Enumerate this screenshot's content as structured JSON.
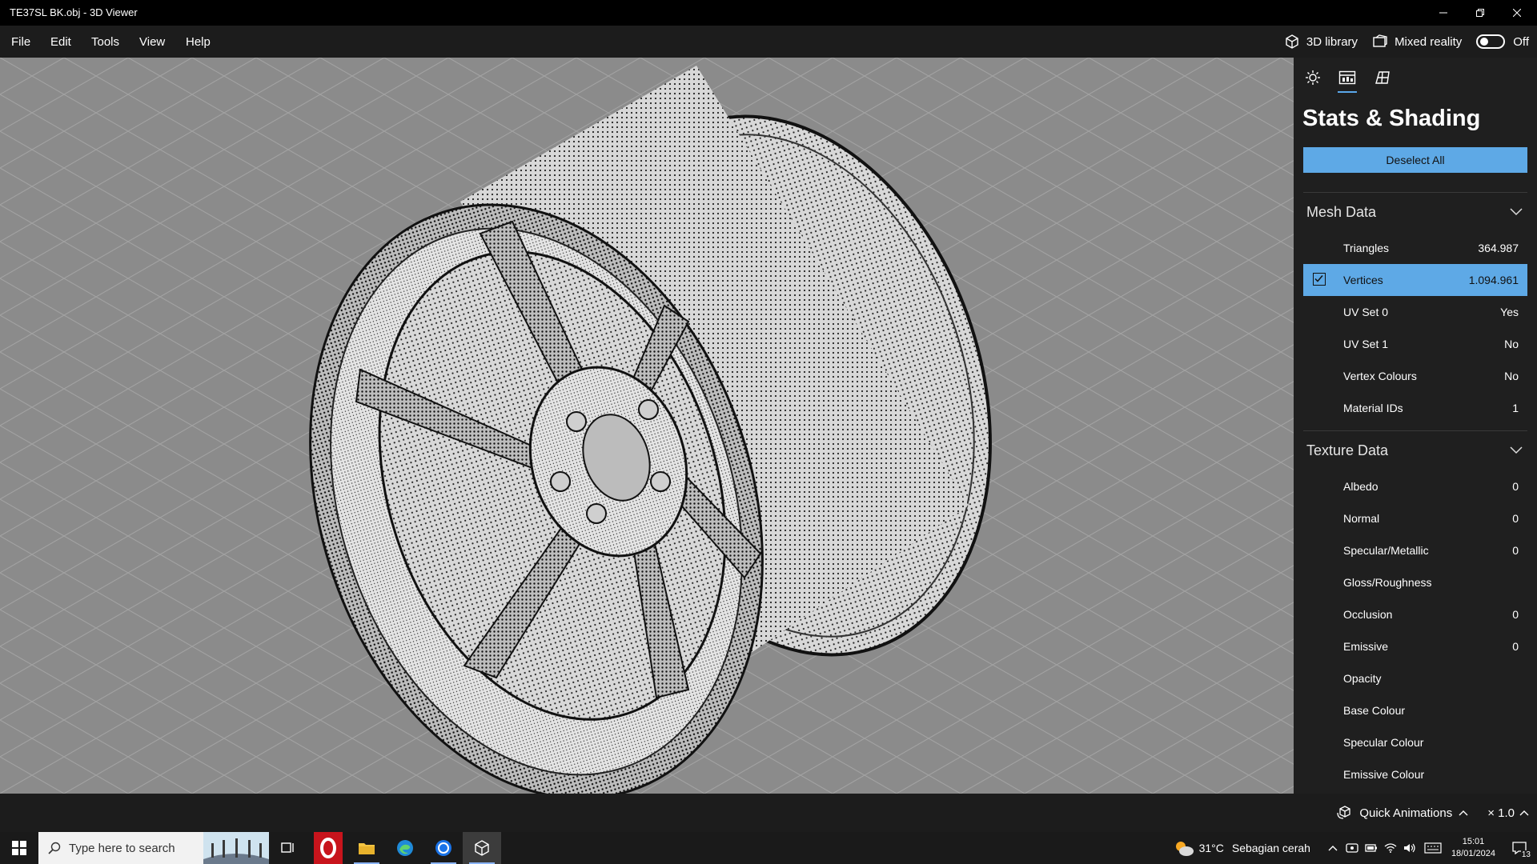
{
  "window": {
    "title": "TE37SL BK.obj - 3D Viewer"
  },
  "menu": [
    "File",
    "Edit",
    "Tools",
    "View",
    "Help"
  ],
  "toolbar": {
    "library_label": "3D library",
    "mixed_reality_label": "Mixed reality",
    "toggle_state": "Off"
  },
  "panel": {
    "title": "Stats & Shading",
    "deselect_label": "Deselect All",
    "mesh_section": "Mesh Data",
    "mesh_rows": [
      {
        "label": "Triangles",
        "value": "364.987"
      },
      {
        "label": "Vertices",
        "value": "1.094.961",
        "selected": true
      },
      {
        "label": "UV Set 0",
        "value": "Yes"
      },
      {
        "label": "UV Set 1",
        "value": "No"
      },
      {
        "label": "Vertex Colours",
        "value": "No"
      },
      {
        "label": "Material IDs",
        "value": "1"
      }
    ],
    "texture_section": "Texture Data",
    "texture_rows": [
      {
        "label": "Albedo",
        "value": "0"
      },
      {
        "label": "Normal",
        "value": "0"
      },
      {
        "label": "Specular/Metallic",
        "value": "0"
      },
      {
        "label": "Gloss/Roughness",
        "value": ""
      },
      {
        "label": "Occlusion",
        "value": "0"
      },
      {
        "label": "Emissive",
        "value": "0"
      },
      {
        "label": "Opacity",
        "value": ""
      },
      {
        "label": "Base Colour",
        "value": ""
      },
      {
        "label": "Specular Colour",
        "value": ""
      },
      {
        "label": "Emissive Colour",
        "value": ""
      }
    ]
  },
  "status": {
    "quick_animations": "Quick Animations",
    "speed": "× 1.0"
  },
  "taskbar": {
    "search_placeholder": "Type here to search",
    "weather": "31°C",
    "weather_desc": "Sebagian cerah",
    "time": "15:01",
    "date": "18/01/2024",
    "notification_count": "13"
  },
  "colors": {
    "accent": "#5ea9e6",
    "panel_bg": "#1f1f1f",
    "viewport_bg": "#8b8b8b"
  }
}
